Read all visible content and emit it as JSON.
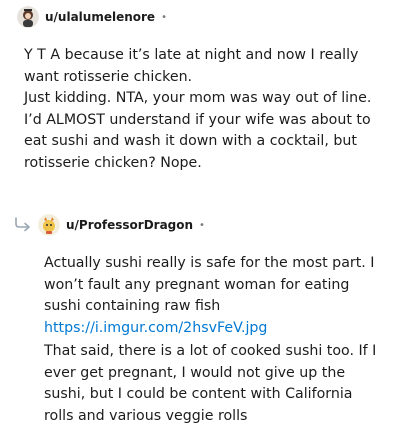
{
  "comment1": {
    "username": "u/ulalumelenore",
    "separator": "•",
    "paragraphs": [
      "Y T A because it’s late at night and now I really want rotisserie chicken.",
      "Just kidding. NTA, your mom was way out of line. I’d ALMOST understand if your wife was about to eat sushi and wash it down with a cocktail, but rotisserie chicken? Nope."
    ]
  },
  "comment2": {
    "username": "u/ProfessorDragon",
    "separator": "•",
    "paragraph1": "Actually sushi really is safe for the most part. I won’t fault any pregnant woman for eating sushi containing raw fish",
    "link": "https://i.imgur.com/2hsvFeV.jpg",
    "paragraph2": "That said, there is a lot of cooked sushi too. If I ever get pregnant, I would not give up the sushi, but I could be content with California rolls and various veggie rolls"
  },
  "colors": {
    "link": "#0079d3",
    "meta": "#7c7c7c",
    "text": "#1c1c1c"
  }
}
